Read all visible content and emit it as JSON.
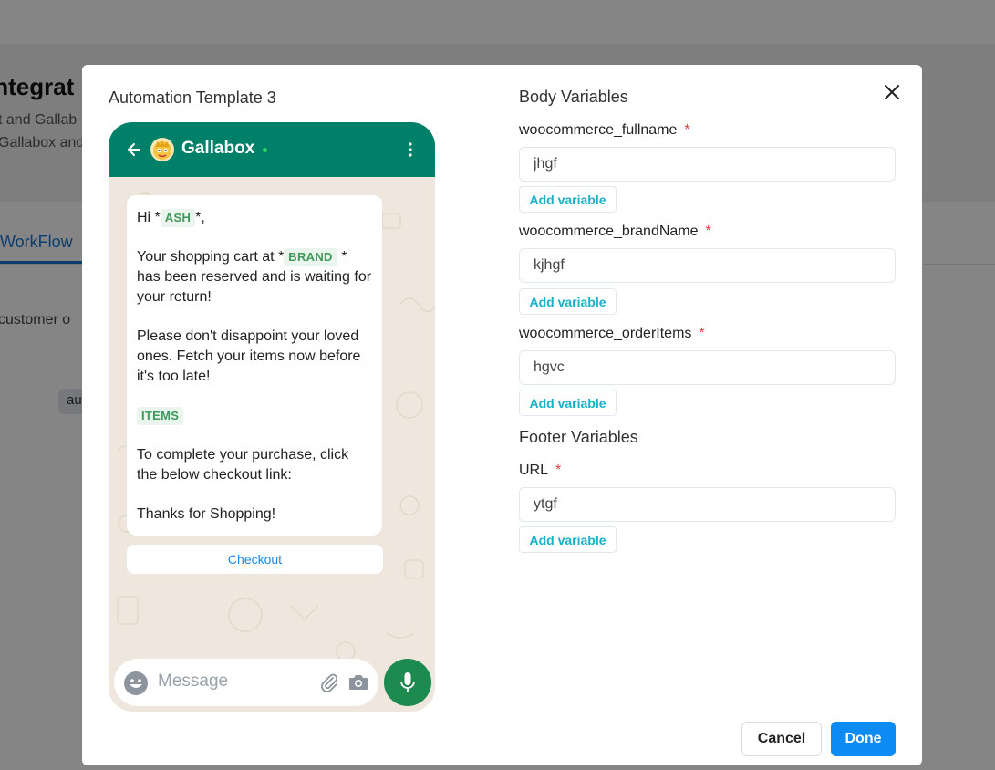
{
  "background": {
    "title": "Integrat",
    "subtitle_line1": "t and Gallab",
    "subtitle_line2": "Gallabox and",
    "tab": "WorkFlow",
    "body_text": "customer o",
    "chip": "au"
  },
  "modal": {
    "title": "Automation Template 3",
    "close_icon": "close-icon"
  },
  "preview": {
    "contact_name": "Gallabox",
    "greeting_prefix": "Hi *",
    "greeting_suffix": "*,",
    "var_name": "ASH",
    "cart_prefix": "Your shopping cart at *",
    "var_brand": "BRAND",
    "cart_suffix": "*",
    "cart_rest": "has been reserved and is waiting for your return!",
    "please_text": "Please don't disappoint your loved ones. Fetch your items now before it's too late!",
    "var_items": "ITEMS",
    "complete_text": "To complete your purchase, click the below checkout link:",
    "thanks_text": "Thanks for Shopping!",
    "button_label": "Checkout",
    "message_placeholder": "Message",
    "colors": {
      "header": "#008069",
      "mic": "#1d8a4f",
      "variable_bg": "#eaf5ee",
      "variable_text": "#3f9a5a"
    }
  },
  "form": {
    "body_title": "Body Variables",
    "footer_title": "Footer Variables",
    "required_mark": "*",
    "add_variable_label": "Add variable",
    "fields": [
      {
        "label": "woocommerce_fullname",
        "value": "jhgf"
      },
      {
        "label": "woocommerce_brandName",
        "value": "kjhgf"
      },
      {
        "label": "woocommerce_orderItems",
        "value": "hgvc"
      },
      {
        "label": "URL",
        "value": "ytgf"
      }
    ]
  },
  "actions": {
    "cancel_label": "Cancel",
    "done_label": "Done",
    "primary_color": "#0d8bf2"
  }
}
